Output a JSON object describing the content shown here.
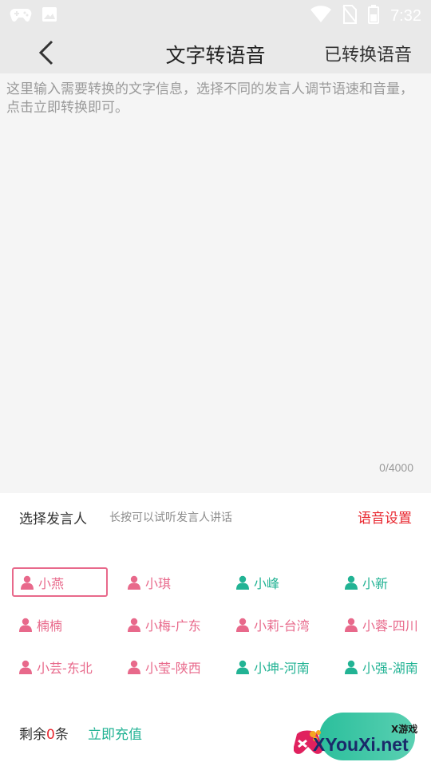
{
  "status_bar": {
    "time": "7:32",
    "icons": [
      "gamepad-icon",
      "image-icon",
      "wifi-icon",
      "no-sim-icon",
      "battery-icon"
    ]
  },
  "app_bar": {
    "back_icon": "chevron-left-icon",
    "title": "文字转语音",
    "right_action": "已转换语音"
  },
  "editor": {
    "placeholder": "这里输入需要转换的文字信息，选择不同的发言人调节语速和音量，点击立即转换即可。",
    "counter": "0/4000"
  },
  "speakers_section": {
    "label": "选择发言人",
    "hint": "长按可以试听发言人讲话",
    "settings": "语音设置",
    "speakers": [
      {
        "name": "小燕",
        "gender": "female",
        "selected": true
      },
      {
        "name": "小琪",
        "gender": "female",
        "selected": false
      },
      {
        "name": "小峰",
        "gender": "male",
        "selected": false
      },
      {
        "name": "小新",
        "gender": "male",
        "selected": false
      },
      {
        "name": "楠楠",
        "gender": "female",
        "selected": false
      },
      {
        "name": "小梅-广东",
        "gender": "female",
        "selected": false
      },
      {
        "name": "小莉-台湾",
        "gender": "female",
        "selected": false
      },
      {
        "name": "小蓉-四川",
        "gender": "female",
        "selected": false
      },
      {
        "name": "小芸-东北",
        "gender": "female",
        "selected": false
      },
      {
        "name": "小莹-陕西",
        "gender": "female",
        "selected": false
      },
      {
        "name": "小坤-河南",
        "gender": "male",
        "selected": false
      },
      {
        "name": "小强-湖南",
        "gender": "male",
        "selected": false
      }
    ]
  },
  "bottom_bar": {
    "remaining_prefix": "剩余",
    "remaining_count": "0",
    "remaining_suffix": "条",
    "recharge": "立即充值"
  },
  "watermark": {
    "small": "X游戏",
    "big": "XYouXi.net"
  },
  "colors": {
    "accent_red": "#e8262e",
    "female": "#e8698b",
    "male": "#22b394",
    "bar_bg": "#e9e9e9"
  }
}
